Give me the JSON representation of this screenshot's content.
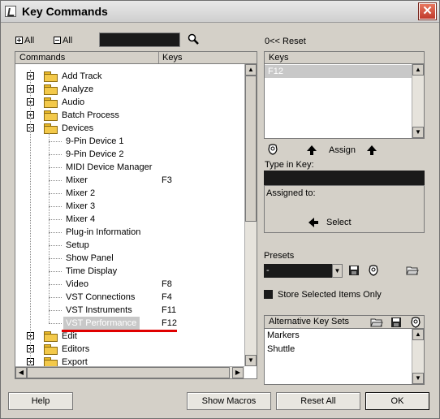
{
  "window": {
    "title": "Key Commands"
  },
  "toolbar": {
    "expand_all": "All",
    "collapse_all": "All",
    "search_value": "",
    "reset": "0<< Reset"
  },
  "commands_panel": {
    "headers": {
      "commands": "Commands",
      "keys": "Keys"
    },
    "items": [
      {
        "label": "Add Track",
        "key": "",
        "type": "folder",
        "expanded": false
      },
      {
        "label": "Analyze",
        "key": "",
        "type": "folder",
        "expanded": false
      },
      {
        "label": "Audio",
        "key": "",
        "type": "folder",
        "expanded": false
      },
      {
        "label": "Batch Process",
        "key": "",
        "type": "folder",
        "expanded": false
      },
      {
        "label": "Devices",
        "key": "",
        "type": "folder",
        "expanded": true
      },
      {
        "label": "9-Pin Device 1",
        "key": "",
        "type": "command"
      },
      {
        "label": "9-Pin Device 2",
        "key": "",
        "type": "command"
      },
      {
        "label": "MIDI Device Manager",
        "key": "",
        "type": "command"
      },
      {
        "label": "Mixer",
        "key": "F3",
        "type": "command"
      },
      {
        "label": "Mixer 2",
        "key": "",
        "type": "command"
      },
      {
        "label": "Mixer 3",
        "key": "",
        "type": "command"
      },
      {
        "label": "Mixer 4",
        "key": "",
        "type": "command"
      },
      {
        "label": "Plug-in Information",
        "key": "",
        "type": "command"
      },
      {
        "label": "Setup",
        "key": "",
        "type": "command"
      },
      {
        "label": "Show Panel",
        "key": "",
        "type": "command"
      },
      {
        "label": "Time Display",
        "key": "",
        "type": "command"
      },
      {
        "label": "Video",
        "key": "F8",
        "type": "command"
      },
      {
        "label": "VST Connections",
        "key": "F4",
        "type": "command"
      },
      {
        "label": "VST Instruments",
        "key": "F11",
        "type": "command"
      },
      {
        "label": "VST Performance",
        "key": "F12",
        "type": "command",
        "selected": true
      },
      {
        "label": "Edit",
        "key": "",
        "type": "folder",
        "expanded": false
      },
      {
        "label": "Editors",
        "key": "",
        "type": "folder",
        "expanded": false
      },
      {
        "label": "Export",
        "key": "",
        "type": "folder",
        "expanded": false
      }
    ]
  },
  "keys_panel": {
    "header": "Keys",
    "items": [
      "F12"
    ]
  },
  "assign": {
    "label": "Assign"
  },
  "type_in_key": {
    "label": "Type in Key:",
    "value": ""
  },
  "assigned_to": {
    "label": "Assigned to:",
    "value": ""
  },
  "select": {
    "label": "Select"
  },
  "presets": {
    "label": "Presets",
    "selected": "-"
  },
  "store_selected": {
    "label": "Store Selected Items Only",
    "checked": false
  },
  "alt_key_sets": {
    "header": "Alternative Key Sets",
    "items": [
      "Markers",
      "Shuttle"
    ]
  },
  "buttons": {
    "help": "Help",
    "show_macros": "Show Macros",
    "reset_all": "Reset All",
    "ok": "OK"
  },
  "colors": {
    "selection": "#c8c8c8",
    "highlight_line": "#e00000",
    "folder": "#f3c94a"
  }
}
